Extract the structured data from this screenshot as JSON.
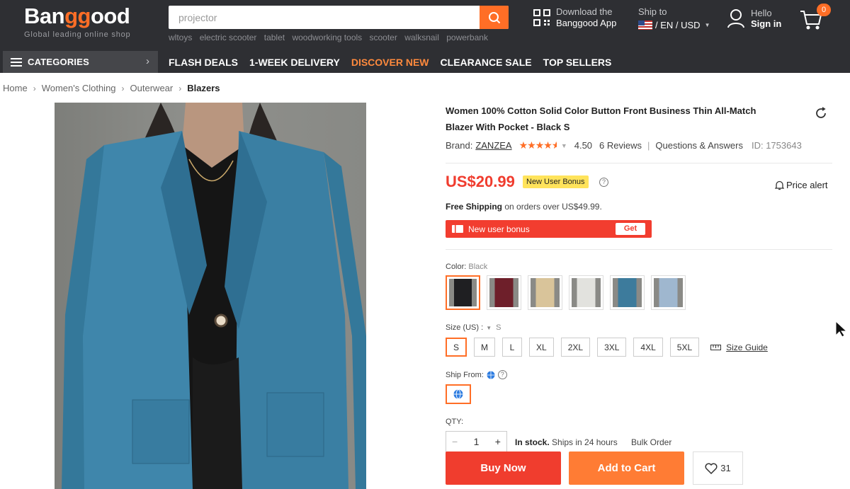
{
  "header": {
    "logo_main_a": "Ban",
    "logo_main_b": "gg",
    "logo_main_c": "ood",
    "logo_tagline": "Global leading online shop",
    "search_placeholder": "projector",
    "hot_searches": [
      "wltoys",
      "electric scooter",
      "tablet",
      "woodworking tools",
      "scooter",
      "walksnail",
      "powerbank"
    ],
    "app_line1": "Download the",
    "app_line2": "Banggood App",
    "ship_to": "Ship to",
    "locale": "/ EN / USD",
    "hello": "Hello",
    "sign_in": "Sign in",
    "cart_count": "0"
  },
  "nav": {
    "categories": "CATEGORIES",
    "items": [
      "FLASH DEALS",
      "1-WEEK DELIVERY",
      "DISCOVER NEW",
      "CLEARANCE SALE",
      "TOP SELLERS"
    ],
    "accent_color": "#ff8a3d"
  },
  "breadcrumb": [
    "Home",
    "Women's Clothing",
    "Outerwear",
    "Blazers"
  ],
  "product": {
    "title": "Women 100% Cotton Solid Color Button Front Business Thin All-Match Blazer With Pocket - Black S",
    "brand_label": "Brand:",
    "brand": "ZANZEA",
    "rating_stars": 4.5,
    "rating": "4.50",
    "reviews": "6 Reviews",
    "qa": "Questions & Answers",
    "id": "ID: 1753643",
    "price": "US$20.99",
    "new_user_tag": "New User Bonus",
    "price_alert": "Price alert",
    "free_shipping": "Free Shipping",
    "free_shipping_note": "on orders over US$49.99.",
    "bonus_bar_text": "New user bonus",
    "bonus_get": "Get",
    "color_label": "Color:",
    "color_value": "Black",
    "colors": [
      {
        "name": "Black",
        "hex": "#1f1f22"
      },
      {
        "name": "Wine Red",
        "hex": "#6e1f2a"
      },
      {
        "name": "Khaki",
        "hex": "#d9c49a"
      },
      {
        "name": "White",
        "hex": "#e2e2de"
      },
      {
        "name": "Blue",
        "hex": "#3d7b9c"
      },
      {
        "name": "Light Blue",
        "hex": "#9fb7cf"
      }
    ],
    "size_label": "Size (US) :",
    "size_value": "S",
    "sizes": [
      "S",
      "M",
      "L",
      "XL",
      "2XL",
      "3XL",
      "4XL",
      "5XL"
    ],
    "size_guide": "Size Guide",
    "ship_from_label": "Ship From:",
    "qty_label": "QTY:",
    "qty": "1",
    "stock_bold": "In stock.",
    "stock_note": "Ships in 24 hours",
    "bulk": "Bulk Order",
    "buy_now": "Buy Now",
    "add_to_cart": "Add to Cart",
    "wishlist_count": "31",
    "main_color": "#f03d2e",
    "brand_color": "#ff6e26"
  }
}
